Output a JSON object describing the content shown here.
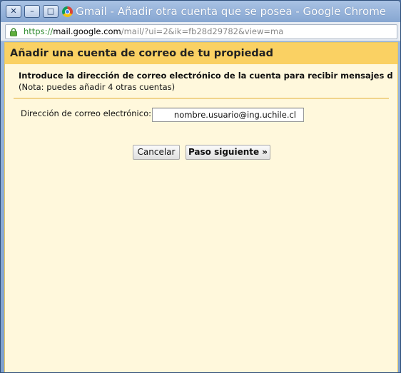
{
  "window": {
    "title": "Gmail - Añadir otra cuenta que se posea - Google Chrome",
    "buttons": {
      "close": "✕",
      "minimize": "–",
      "maximize": "□"
    }
  },
  "address_bar": {
    "scheme": "https://",
    "host": "mail.google.com",
    "path": "/mail/?ui=2&ik=fb28d29782&view=ma"
  },
  "dialog": {
    "title": "Añadir una cuenta de correo de tu propiedad",
    "intro": "Introduce la dirección de correo electrónico de la cuenta para recibir mensajes de",
    "note": "(Nota: puedes añadir 4 otras cuentas)",
    "email_label": "Dirección de correo electrónico:",
    "email_value": "nombre.usuario@ing.uchile.cl",
    "cancel_label": "Cancelar",
    "next_label": "Paso siguiente »"
  },
  "colors": {
    "header_band": "#fad163",
    "panel_background": "#fff8dc",
    "url_scheme": "#2e8b2e"
  }
}
